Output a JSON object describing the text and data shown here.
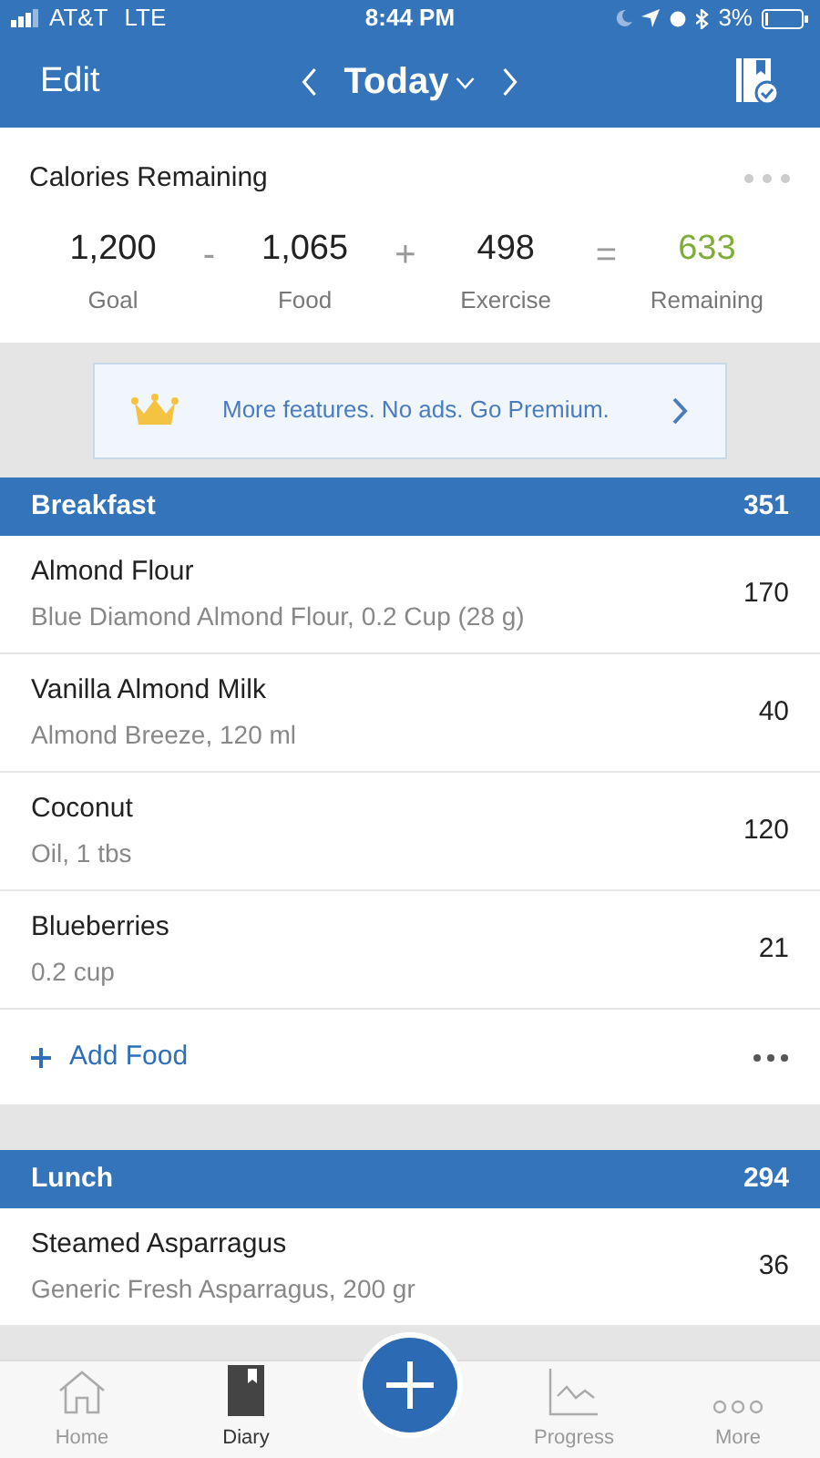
{
  "status_bar": {
    "carrier": "AT&T",
    "network": "LTE",
    "time": "8:44 PM",
    "battery": "3%"
  },
  "nav": {
    "edit": "Edit",
    "title": "Today"
  },
  "summary": {
    "title": "Calories Remaining",
    "items": [
      {
        "kind": "value",
        "value": "1,200",
        "label": "Goal"
      },
      {
        "kind": "operator",
        "value": "-"
      },
      {
        "kind": "value",
        "value": "1,065",
        "label": "Food"
      },
      {
        "kind": "operator",
        "value": "+"
      },
      {
        "kind": "value",
        "value": "498",
        "label": "Exercise"
      },
      {
        "kind": "operator",
        "value": "="
      },
      {
        "kind": "result",
        "value": "633",
        "label": "Remaining"
      }
    ]
  },
  "banner": {
    "text": "More features. No ads. Go Premium."
  },
  "meals": [
    {
      "name": "Breakfast",
      "calories": "351",
      "foods": [
        {
          "name": "Almond Flour",
          "detail": "Blue Diamond Almond Flour, 0.2 Cup (28 g)",
          "calories": "170"
        },
        {
          "name": "Vanilla Almond Milk",
          "detail": "Almond Breeze, 120 ml",
          "calories": "40"
        },
        {
          "name": "Coconut",
          "detail": "Oil, 1 tbs",
          "calories": "120"
        },
        {
          "name": "Blueberries",
          "detail": "0.2 cup",
          "calories": "21"
        }
      ],
      "add_food": "Add Food"
    },
    {
      "name": "Lunch",
      "calories": "294",
      "foods": [
        {
          "name": "Steamed Asparragus",
          "detail": "Generic Fresh Asparragus, 200 gr",
          "calories": "36"
        }
      ]
    }
  ],
  "tab_bar": [
    {
      "kind": "home",
      "label": "Home",
      "selected": false
    },
    {
      "kind": "diary",
      "label": "Diary",
      "selected": true
    },
    {
      "kind": "add"
    },
    {
      "kind": "progress",
      "label": "Progress",
      "selected": false
    },
    {
      "kind": "more",
      "label": "More",
      "selected": false
    }
  ]
}
